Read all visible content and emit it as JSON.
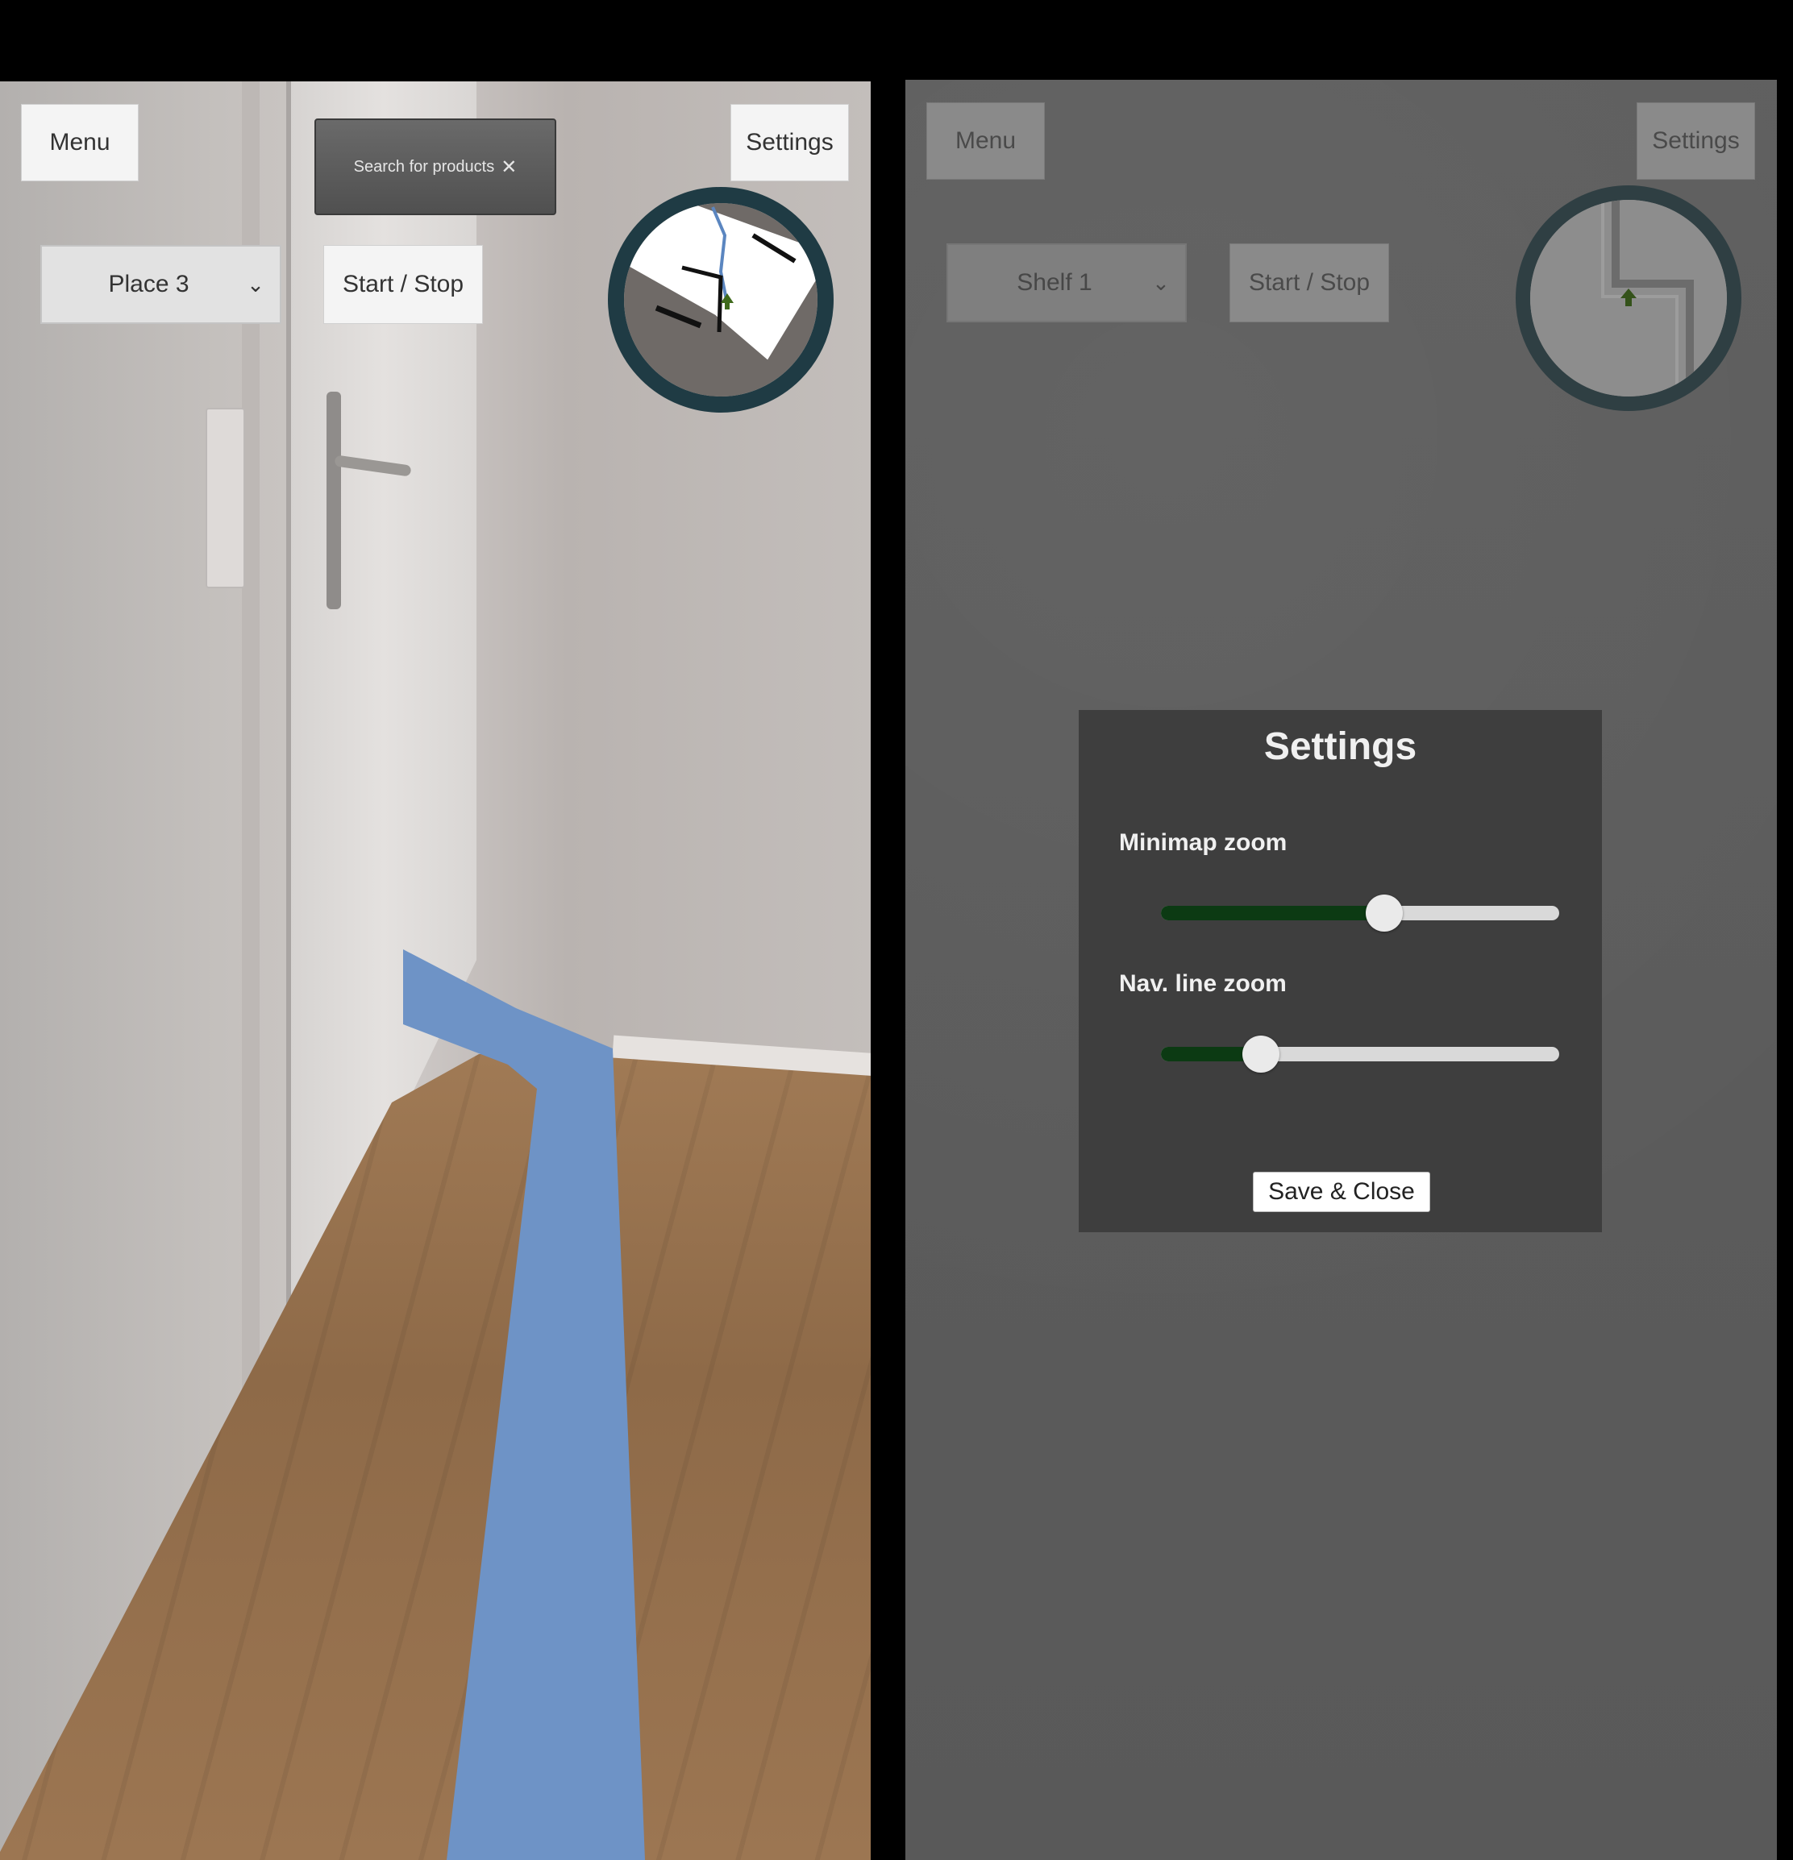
{
  "left_screen": {
    "menu_label": "Menu",
    "settings_label": "Settings",
    "search": {
      "text": "Search for products",
      "clear_icon": "close-icon"
    },
    "destination": {
      "selected": "Place 3",
      "icon": "chevron-down-icon"
    },
    "start_stop_label": "Start / Stop",
    "minimap": {
      "ring_color": "#1f3b44",
      "player_marker": "arrow-up-icon"
    },
    "nav_line_color": "#6e93c6"
  },
  "right_screen": {
    "menu_label": "Menu",
    "settings_label": "Settings",
    "destination": {
      "selected": "Shelf 1",
      "icon": "chevron-down-icon"
    },
    "start_stop_label": "Start / Stop",
    "minimap": {
      "ring_color": "#2f3f43",
      "player_marker": "arrow-up-icon"
    },
    "settings_panel": {
      "title": "Settings",
      "minimap_zoom": {
        "label": "Minimap zoom",
        "value_fraction": 0.56
      },
      "nav_line_zoom": {
        "label": "Nav. line zoom",
        "value_fraction": 0.25
      },
      "save_label": "Save & Close",
      "slider_fill_color": "#0c3a13"
    }
  }
}
